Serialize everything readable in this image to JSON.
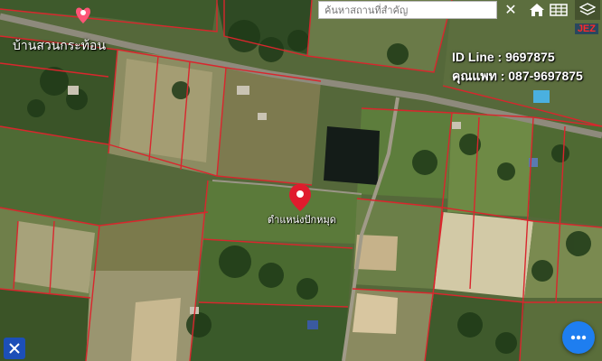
{
  "map": {
    "type": "satellite",
    "place_label": "บ้านสวนกระท้อน",
    "pin_label": "ตำแหน่งปักหมุด"
  },
  "search": {
    "placeholder": "ค้นหาสถานที่สำคัญ"
  },
  "toolbar": {
    "clear_icon": "close-icon",
    "home_icon": "home-icon",
    "grid_icon": "grid-icon",
    "layers_icon": "layers-icon"
  },
  "overlay": {
    "brand": "JEZ",
    "line_id": "ID Line : 9697875",
    "phone": "คุณแพท : 087-9697875"
  },
  "colors": {
    "parcel_lines": "#d9262d",
    "pin": "#e01b2d",
    "fab": "#1e7ef0",
    "corner_button": "#1c4fb8"
  }
}
